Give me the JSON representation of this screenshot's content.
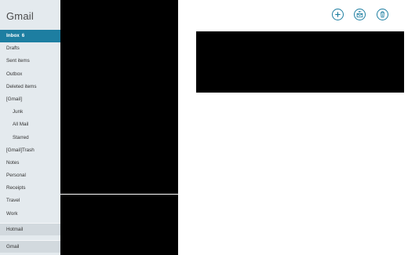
{
  "app": {
    "title": "Gmail"
  },
  "folders": [
    {
      "label": "Inbox",
      "count": "6",
      "selected": true
    },
    {
      "label": "Drafts"
    },
    {
      "label": "Sent items"
    },
    {
      "label": "Outbox"
    },
    {
      "label": "Deleted items"
    },
    {
      "label": "[Gmail]"
    },
    {
      "label": "Junk"
    },
    {
      "label": "All Mail"
    },
    {
      "label": "Starred"
    },
    {
      "label": "[Gmail]Trash"
    },
    {
      "label": "Notes"
    },
    {
      "label": "Personal"
    },
    {
      "label": "Receipts"
    },
    {
      "label": "Travel"
    },
    {
      "label": "Work"
    }
  ],
  "accounts": [
    {
      "label": "Hotmail"
    },
    {
      "label": "Gmail"
    }
  ],
  "toolbar": {
    "buttons": [
      {
        "icon": "plus-icon"
      },
      {
        "icon": "reply-icon"
      },
      {
        "icon": "trash-icon"
      }
    ]
  },
  "colors": {
    "accent": "#1d7ea1",
    "sidebar_bg": "#e4eaee",
    "account_bg": "#d2d9de"
  }
}
